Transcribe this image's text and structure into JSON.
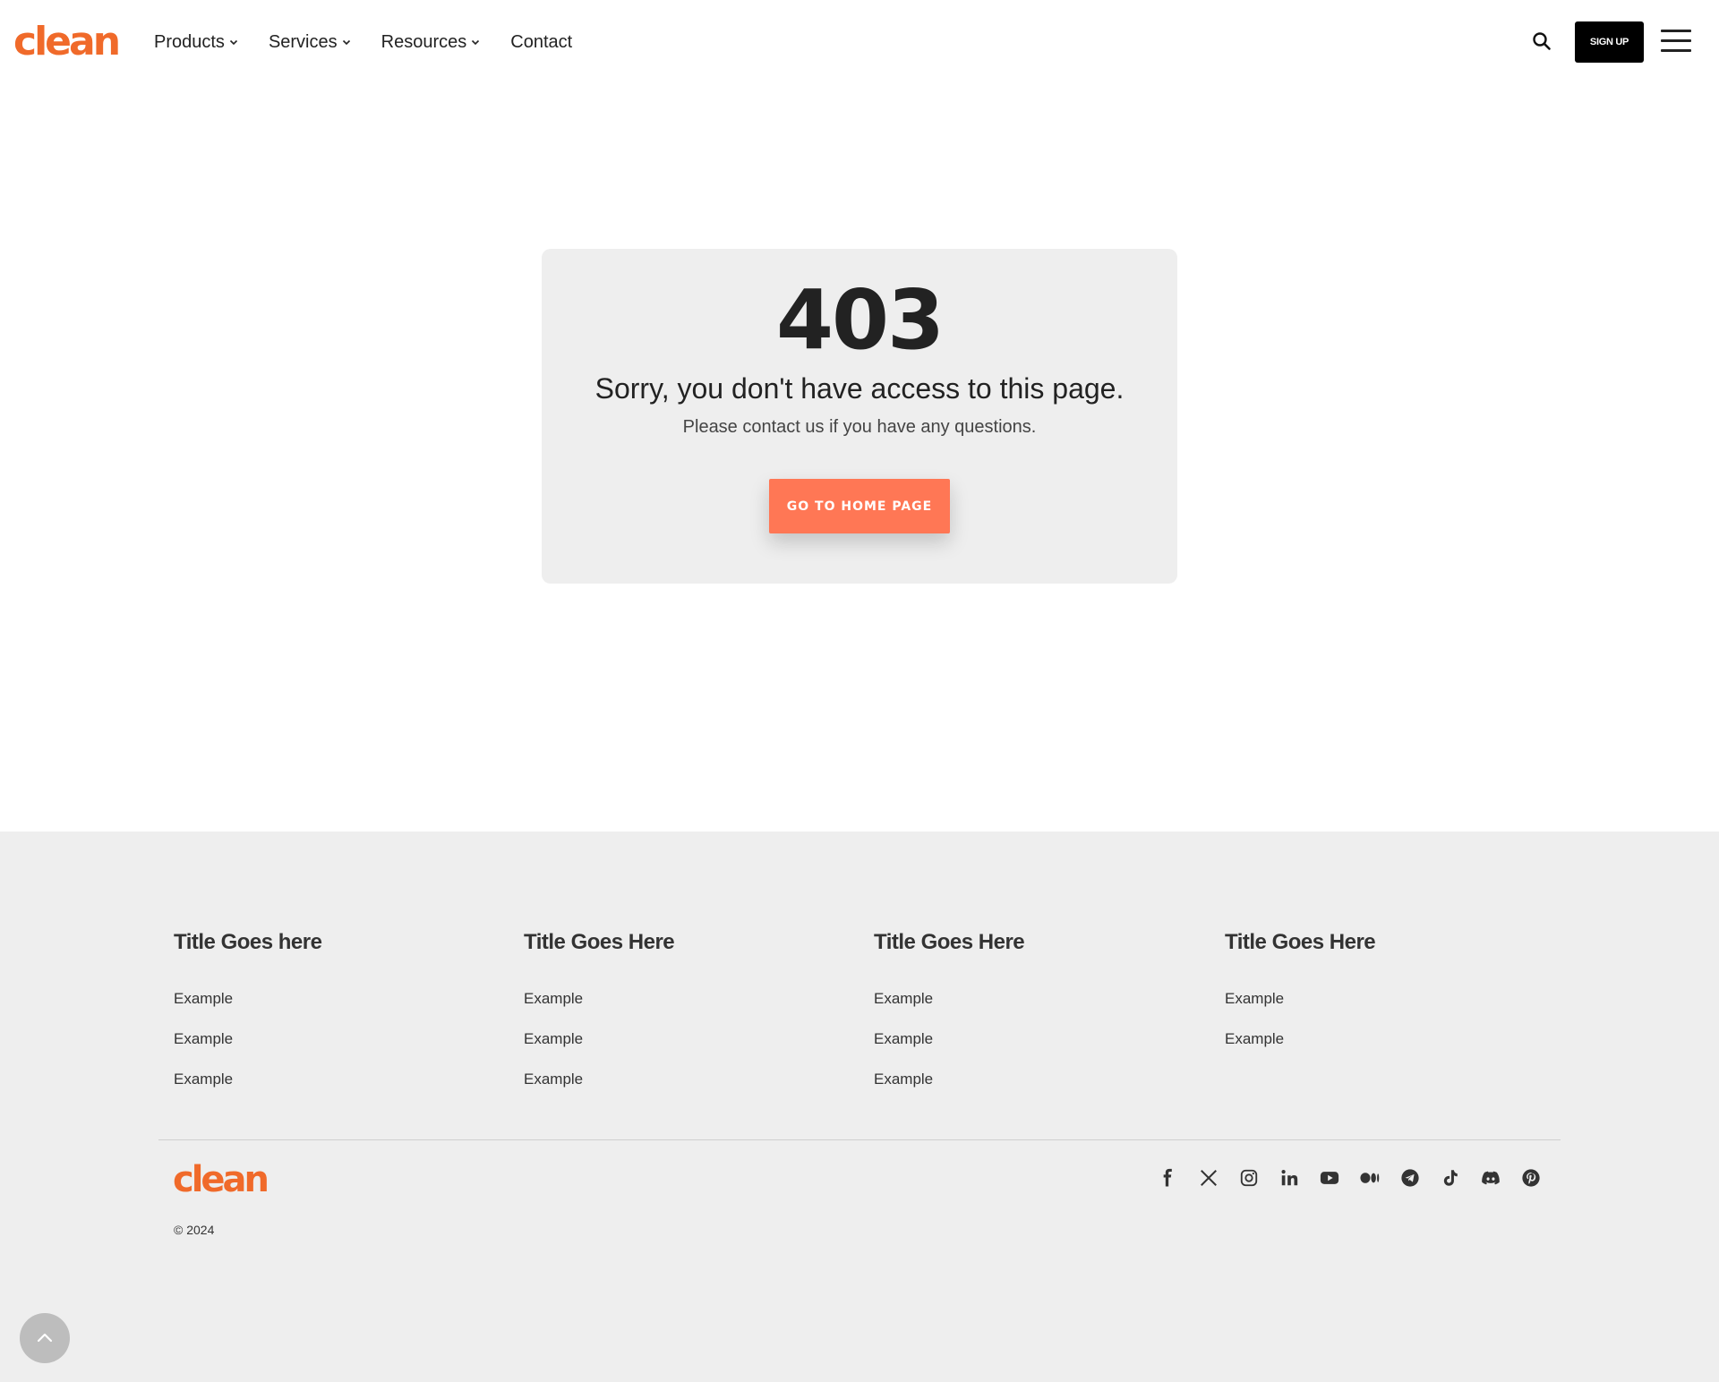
{
  "header": {
    "logo": "clean",
    "nav": [
      {
        "label": "Products",
        "has_dropdown": true
      },
      {
        "label": "Services",
        "has_dropdown": true
      },
      {
        "label": "Resources",
        "has_dropdown": true
      },
      {
        "label": "Contact",
        "has_dropdown": false
      }
    ],
    "search_icon": "search-icon",
    "signup_label": "SIGN UP",
    "menu_icon": "hamburger-icon"
  },
  "error": {
    "code": "403",
    "message": "Sorry, you don't have access to this page.",
    "sub": "Please contact us if you have any questions.",
    "button_label": "GO TO HOME PAGE"
  },
  "footer": {
    "columns": [
      {
        "title": "Title Goes here",
        "links": [
          "Example",
          "Example",
          "Example"
        ]
      },
      {
        "title": "Title Goes Here",
        "links": [
          "Example",
          "Example",
          "Example"
        ]
      },
      {
        "title": "Title Goes Here",
        "links": [
          "Example",
          "Example",
          "Example"
        ]
      },
      {
        "title": "Title Goes Here",
        "links": [
          "Example",
          "Example"
        ]
      }
    ],
    "logo": "clean",
    "copyright": "© 2024",
    "socials": [
      "facebook-icon",
      "x-icon",
      "instagram-icon",
      "linkedin-icon",
      "youtube-icon",
      "medium-icon",
      "telegram-icon",
      "tiktok-icon",
      "discord-icon",
      "pinterest-icon"
    ]
  },
  "back_to_top_icon": "chevron-up-icon",
  "colors": {
    "brand": "#f06a2a",
    "button": "#ff7755",
    "card_bg": "#eeeeee",
    "footer_bg": "#eeeeee",
    "text": "#222222"
  }
}
